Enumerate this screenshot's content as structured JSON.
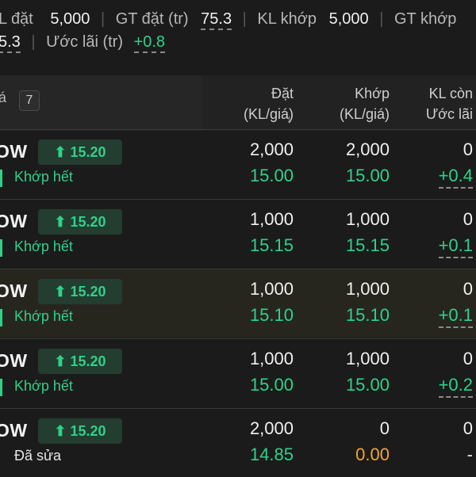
{
  "summary": {
    "ordered_qty_label": "L đặt",
    "ordered_qty": "5,000",
    "ordered_value_label": "GT đặt (tr)",
    "ordered_value": "75.3",
    "matched_qty_label": "KL khớp",
    "matched_qty": "5,000",
    "matched_value_label": "GT khớp",
    "matched_value": "5.3",
    "est_profit_label": "Ước lãi (tr)",
    "est_profit": "+0.8"
  },
  "header": {
    "col_left": "á",
    "count": "7",
    "col_order_line1": "Đặt",
    "col_order_line2": "(KL/giá)",
    "col_match_line1": "Khớp",
    "col_match_line2": "(KL/giá)",
    "col_remain_line1": "KL còn",
    "col_remain_line2": "Ước lãi"
  },
  "rows": [
    {
      "symbol": "OW",
      "badge": "⬆ 15.20",
      "status": "Khớp hết",
      "order_qty": "2,000",
      "order_price": "15.00",
      "match_qty": "2,000",
      "match_price": "15.00",
      "remain": "0",
      "profit": "+0.4"
    },
    {
      "symbol": "OW",
      "badge": "⬆ 15.20",
      "status": "Khớp hết",
      "order_qty": "1,000",
      "order_price": "15.15",
      "match_qty": "1,000",
      "match_price": "15.15",
      "remain": "0",
      "profit": "+0.1"
    },
    {
      "symbol": "OW",
      "badge": "⬆ 15.20",
      "status": "Khớp hết",
      "order_qty": "1,000",
      "order_price": "15.10",
      "match_qty": "1,000",
      "match_price": "15.10",
      "remain": "0",
      "profit": "+0.1"
    },
    {
      "symbol": "OW",
      "badge": "⬆ 15.20",
      "status": "Khớp hết",
      "order_qty": "1,000",
      "order_price": "15.00",
      "match_qty": "1,000",
      "match_price": "15.00",
      "remain": "0",
      "profit": "+0.2"
    },
    {
      "symbol": "OW",
      "badge": "⬆ 15.20",
      "status": "Đã sửa",
      "order_qty": "2,000",
      "order_price": "14.85",
      "match_qty": "0",
      "match_price": "0.00",
      "remain": "0",
      "profit": "-"
    }
  ],
  "colors": {
    "up": "#2fd18a",
    "neutral": "#f0a43c",
    "background": "#1b1b1b"
  }
}
